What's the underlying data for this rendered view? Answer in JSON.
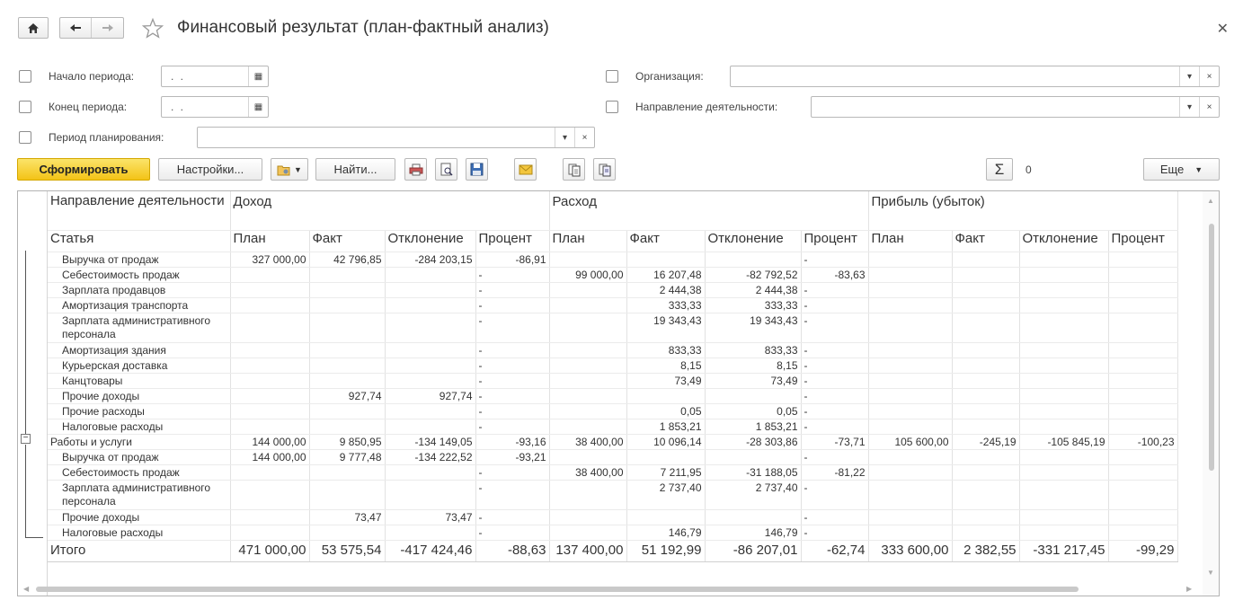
{
  "window": {
    "title": "Финансовый результат (план-фактный анализ)"
  },
  "filters": {
    "start_label": "Начало периода:",
    "start_value": ". .",
    "end_label": "Конец периода:",
    "end_value": ". .",
    "planning_label": "Период планирования:",
    "organization_label": "Организация:",
    "direction_label": "Направление деятельности:"
  },
  "toolbar": {
    "generate_label": "Сформировать",
    "settings_label": "Настройки...",
    "find_label": "Найти...",
    "sum_value": "0",
    "more_label": "Еще"
  },
  "table": {
    "header_row1": {
      "col1": "Направление деятельности",
      "income": "Доход",
      "expense": "Расход",
      "profit": "Прибыль (убыток)"
    },
    "header_row2": [
      "Статья",
      "План",
      "Факт",
      "Отклонение",
      "Процент",
      "План",
      "Факт",
      "Отклонение",
      "Процент",
      "План",
      "Факт",
      "Отклонение",
      "Процент"
    ],
    "rows": [
      {
        "kind": "child",
        "cells": [
          "Выручка от продаж",
          "327 000,00",
          "42 796,85",
          "-284 203,15",
          "-86,91",
          "",
          "",
          "",
          "-",
          "",
          "",
          "",
          ""
        ]
      },
      {
        "kind": "child",
        "cells": [
          "Себестоимость продаж",
          "",
          "",
          "",
          "-",
          "99 000,00",
          "16 207,48",
          "-82 792,52",
          "-83,63",
          "",
          "",
          "",
          ""
        ]
      },
      {
        "kind": "child",
        "cells": [
          "Зарплата продавцов",
          "",
          "",
          "",
          "-",
          "",
          "2 444,38",
          "2 444,38",
          "-",
          "",
          "",
          "",
          ""
        ]
      },
      {
        "kind": "child",
        "cells": [
          "Амортизация транспорта",
          "",
          "",
          "",
          "-",
          "",
          "333,33",
          "333,33",
          "-",
          "",
          "",
          "",
          ""
        ]
      },
      {
        "kind": "child-tall",
        "cells": [
          "Зарплата административного персонала",
          "",
          "",
          "",
          "-",
          "",
          "19 343,43",
          "19 343,43",
          "-",
          "",
          "",
          "",
          ""
        ]
      },
      {
        "kind": "child",
        "cells": [
          "Амортизация здания",
          "",
          "",
          "",
          "-",
          "",
          "833,33",
          "833,33",
          "-",
          "",
          "",
          "",
          ""
        ]
      },
      {
        "kind": "child",
        "cells": [
          "Курьерская доставка",
          "",
          "",
          "",
          "-",
          "",
          "8,15",
          "8,15",
          "-",
          "",
          "",
          "",
          ""
        ]
      },
      {
        "kind": "child",
        "cells": [
          "Канцтовары",
          "",
          "",
          "",
          "-",
          "",
          "73,49",
          "73,49",
          "-",
          "",
          "",
          "",
          ""
        ]
      },
      {
        "kind": "child",
        "cells": [
          "Прочие доходы",
          "",
          "927,74",
          "927,74",
          "-",
          "",
          "",
          "",
          "-",
          "",
          "",
          "",
          ""
        ]
      },
      {
        "kind": "child",
        "cells": [
          "Прочие расходы",
          "",
          "",
          "",
          "-",
          "",
          "0,05",
          "0,05",
          "-",
          "",
          "",
          "",
          ""
        ]
      },
      {
        "kind": "child",
        "cells": [
          "Налоговые расходы",
          "",
          "",
          "",
          "-",
          "",
          "1 853,21",
          "1 853,21",
          "-",
          "",
          "",
          "",
          ""
        ]
      },
      {
        "kind": "group",
        "cells": [
          "Работы и услуги",
          "144 000,00",
          "9 850,95",
          "-134 149,05",
          "-93,16",
          "38 400,00",
          "10 096,14",
          "-28 303,86",
          "-73,71",
          "105 600,00",
          "-245,19",
          "-105 845,19",
          "-100,23"
        ]
      },
      {
        "kind": "child",
        "cells": [
          "Выручка от продаж",
          "144 000,00",
          "9 777,48",
          "-134 222,52",
          "-93,21",
          "",
          "",
          "",
          "-",
          "",
          "",
          "",
          ""
        ]
      },
      {
        "kind": "child",
        "cells": [
          "Себестоимость продаж",
          "",
          "",
          "",
          "-",
          "38 400,00",
          "7 211,95",
          "-31 188,05",
          "-81,22",
          "",
          "",
          "",
          ""
        ]
      },
      {
        "kind": "child-tall",
        "cells": [
          "Зарплата административного персонала",
          "",
          "",
          "",
          "-",
          "",
          "2 737,40",
          "2 737,40",
          "-",
          "",
          "",
          "",
          ""
        ]
      },
      {
        "kind": "child",
        "cells": [
          "Прочие доходы",
          "",
          "73,47",
          "73,47",
          "-",
          "",
          "",
          "",
          "-",
          "",
          "",
          "",
          ""
        ]
      },
      {
        "kind": "child",
        "cells": [
          "Налоговые расходы",
          "",
          "",
          "",
          "-",
          "",
          "146,79",
          "146,79",
          "-",
          "",
          "",
          "",
          ""
        ]
      },
      {
        "kind": "total",
        "cells": [
          "Итого",
          "471 000,00",
          "53 575,54",
          "-417 424,46",
          "-88,63",
          "137 400,00",
          "51 192,99",
          "-86 207,01",
          "-62,74",
          "333 600,00",
          "2 382,55",
          "-331 217,45",
          "-99,29"
        ]
      }
    ]
  }
}
